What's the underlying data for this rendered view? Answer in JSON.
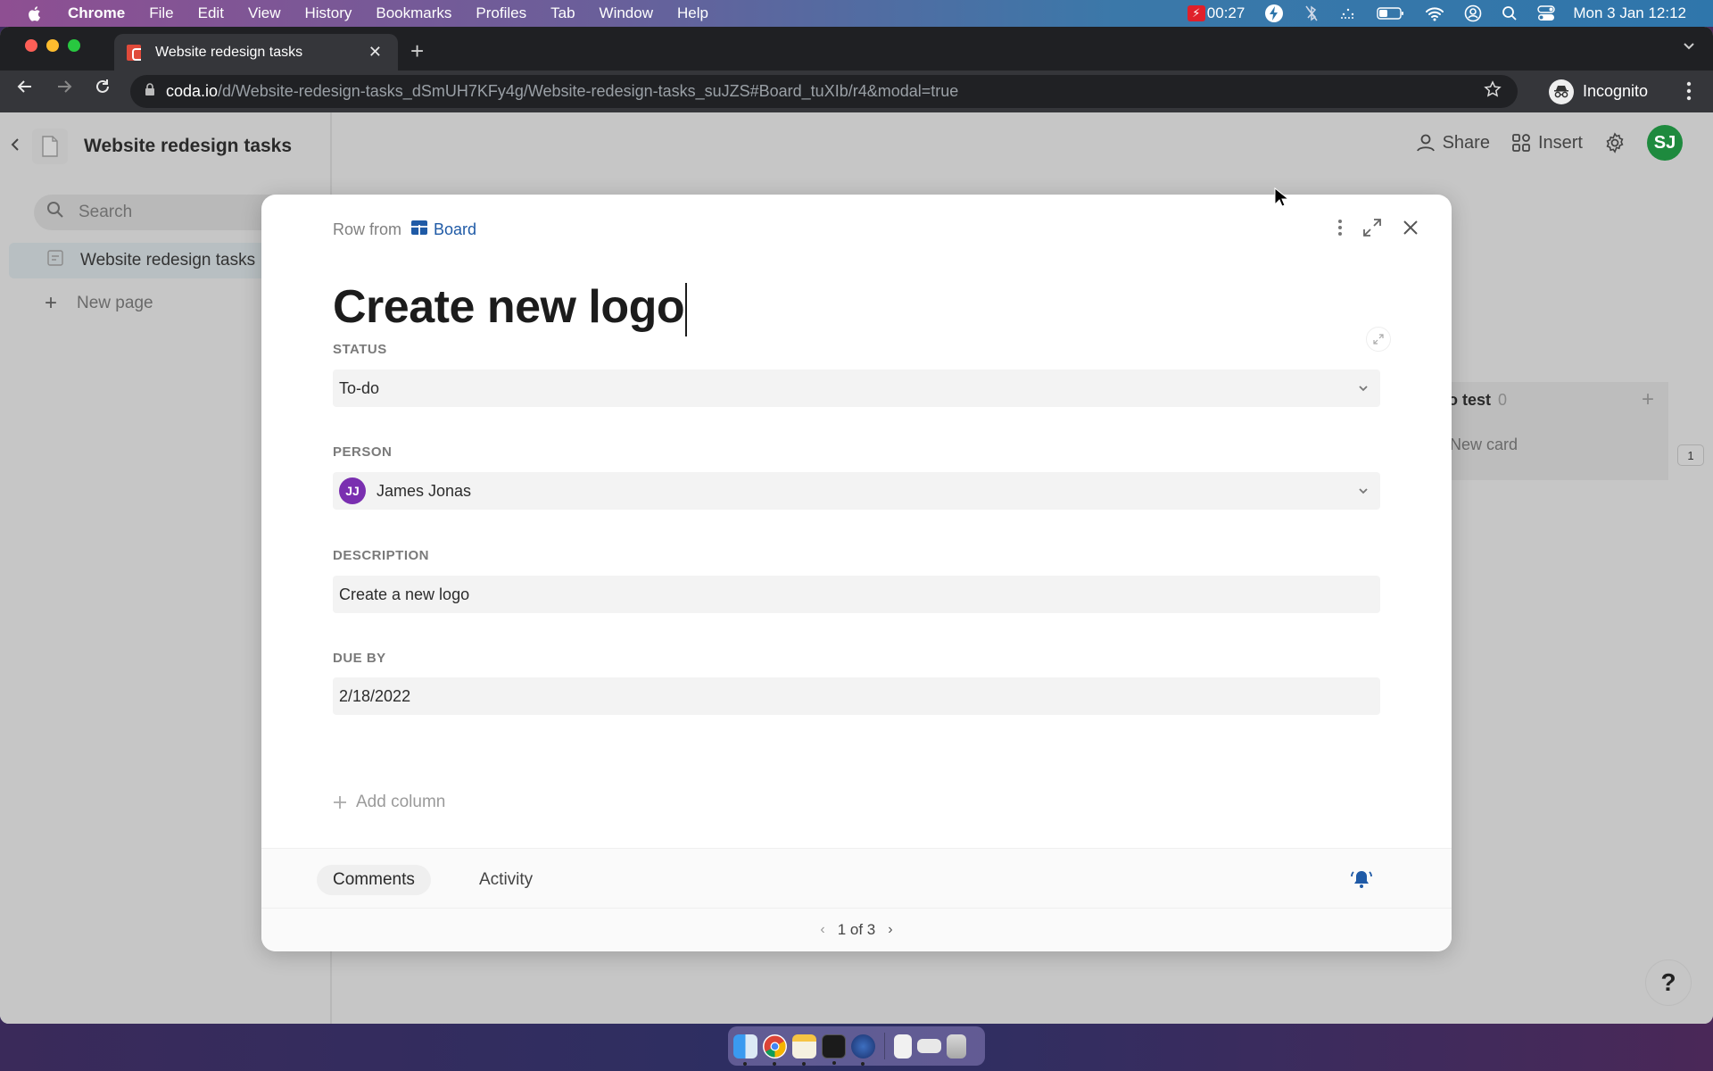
{
  "menubar": {
    "app": "Chrome",
    "items": [
      "File",
      "Edit",
      "View",
      "History",
      "Bookmarks",
      "Profiles",
      "Tab",
      "Window",
      "Help"
    ],
    "recording_time": "00:27",
    "clock": "Mon 3 Jan  12:12"
  },
  "browser": {
    "tab_title": "Website redesign tasks",
    "url_host": "coda.io",
    "url_path": "/d/Website-redesign-tasks_dSmUH7KFy4g/Website-redesign-tasks_suJZS#Board_tuXIb/r4&modal=true",
    "profile_label": "Incognito"
  },
  "sidebar": {
    "doc_title": "Website redesign tasks",
    "search_placeholder": "Search",
    "pages": [
      {
        "label": "Website redesign tasks"
      }
    ],
    "new_page_label": "New page"
  },
  "header": {
    "share_label": "Share",
    "insert_label": "Insert",
    "avatar_initials": "SJ"
  },
  "board": {
    "column_title": "o test",
    "column_count": "0",
    "new_card_label": "New card",
    "page_indicator": "1"
  },
  "modal": {
    "row_from_label": "Row from",
    "source_table": "Board",
    "title": "Create new logo",
    "fields": [
      {
        "label": "STATUS",
        "value": "To-do"
      },
      {
        "label": "PERSON",
        "value": "James Jonas",
        "initials": "JJ"
      },
      {
        "label": "DESCRIPTION",
        "value": "Create a new logo"
      },
      {
        "label": "DUE BY",
        "value": "2/18/2022"
      }
    ],
    "add_column_label": "Add column",
    "tabs": [
      "Comments",
      "Activity"
    ],
    "pager": "1 of 3"
  },
  "help_label": "?",
  "colors": {
    "accent": "#1f5aa6",
    "avatar_sj": "#1e8a3e",
    "avatar_jj": "#7a2fb0"
  }
}
